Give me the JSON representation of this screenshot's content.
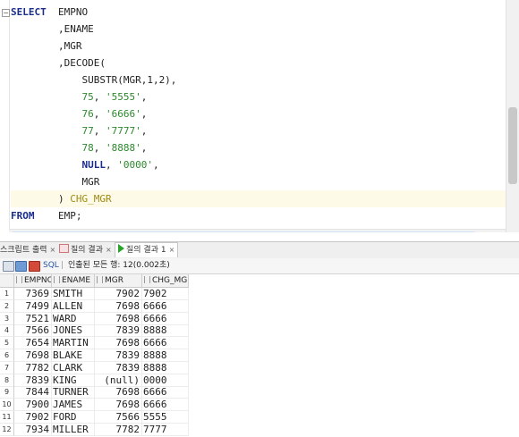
{
  "editor": {
    "lines": [
      {
        "kw": "SELECT",
        "rest": "  EMPNO"
      },
      {
        "text": "        ,ENAME"
      },
      {
        "text": "        ,MGR"
      },
      {
        "text": "        ,DECODE("
      },
      {
        "text": "            SUBSTR(MGR,1,2),"
      },
      {
        "num": "75",
        "str": "'5555'"
      },
      {
        "num": "76",
        "str": "'6666'"
      },
      {
        "num": "77",
        "str": "'7777'"
      },
      {
        "num": "78",
        "str": "'8888'"
      },
      {
        "kw": "NULL",
        "str": "'0000'"
      },
      {
        "text": "            MGR"
      },
      {
        "text": "        ) ",
        "alias": "CHG_MGR"
      },
      {
        "kw": "FROM",
        "rest": "    EMP;"
      }
    ]
  },
  "tabs": [
    {
      "label": "스크립트 출력",
      "close": "×"
    },
    {
      "label": "질의 결과",
      "close": "×"
    },
    {
      "label": "질의 결과 1",
      "close": "×",
      "active": true
    }
  ],
  "toolbar": {
    "sql_label": "SQL",
    "separator": "|",
    "status": "인출된 모든 행: 12(0.002초)"
  },
  "grid": {
    "columns": [
      "EMPNO",
      "ENAME",
      "MGR",
      "CHG_MGR"
    ],
    "rows": [
      {
        "n": "1",
        "empno": "7369",
        "ename": "SMITH",
        "mgr": "7902",
        "chg": "7902"
      },
      {
        "n": "2",
        "empno": "7499",
        "ename": "ALLEN",
        "mgr": "7698",
        "chg": "6666"
      },
      {
        "n": "3",
        "empno": "7521",
        "ename": "WARD",
        "mgr": "7698",
        "chg": "6666"
      },
      {
        "n": "4",
        "empno": "7566",
        "ename": "JONES",
        "mgr": "7839",
        "chg": "8888"
      },
      {
        "n": "5",
        "empno": "7654",
        "ename": "MARTIN",
        "mgr": "7698",
        "chg": "6666"
      },
      {
        "n": "6",
        "empno": "7698",
        "ename": "BLAKE",
        "mgr": "7839",
        "chg": "8888"
      },
      {
        "n": "7",
        "empno": "7782",
        "ename": "CLARK",
        "mgr": "7839",
        "chg": "8888"
      },
      {
        "n": "8",
        "empno": "7839",
        "ename": "KING",
        "mgr": "(null)",
        "chg": "0000"
      },
      {
        "n": "9",
        "empno": "7844",
        "ename": "TURNER",
        "mgr": "7698",
        "chg": "6666"
      },
      {
        "n": "10",
        "empno": "7900",
        "ename": "JAMES",
        "mgr": "7698",
        "chg": "6666"
      },
      {
        "n": "11",
        "empno": "7902",
        "ename": "FORD",
        "mgr": "7566",
        "chg": "5555"
      },
      {
        "n": "12",
        "empno": "7934",
        "ename": "MILLER",
        "mgr": "7782",
        "chg": "7777"
      }
    ]
  },
  "colors": {
    "keyword": "#1a2d8b",
    "literal": "#2c8a2c",
    "alias": "#9e8a14",
    "highlight": "#fdfbe7"
  }
}
